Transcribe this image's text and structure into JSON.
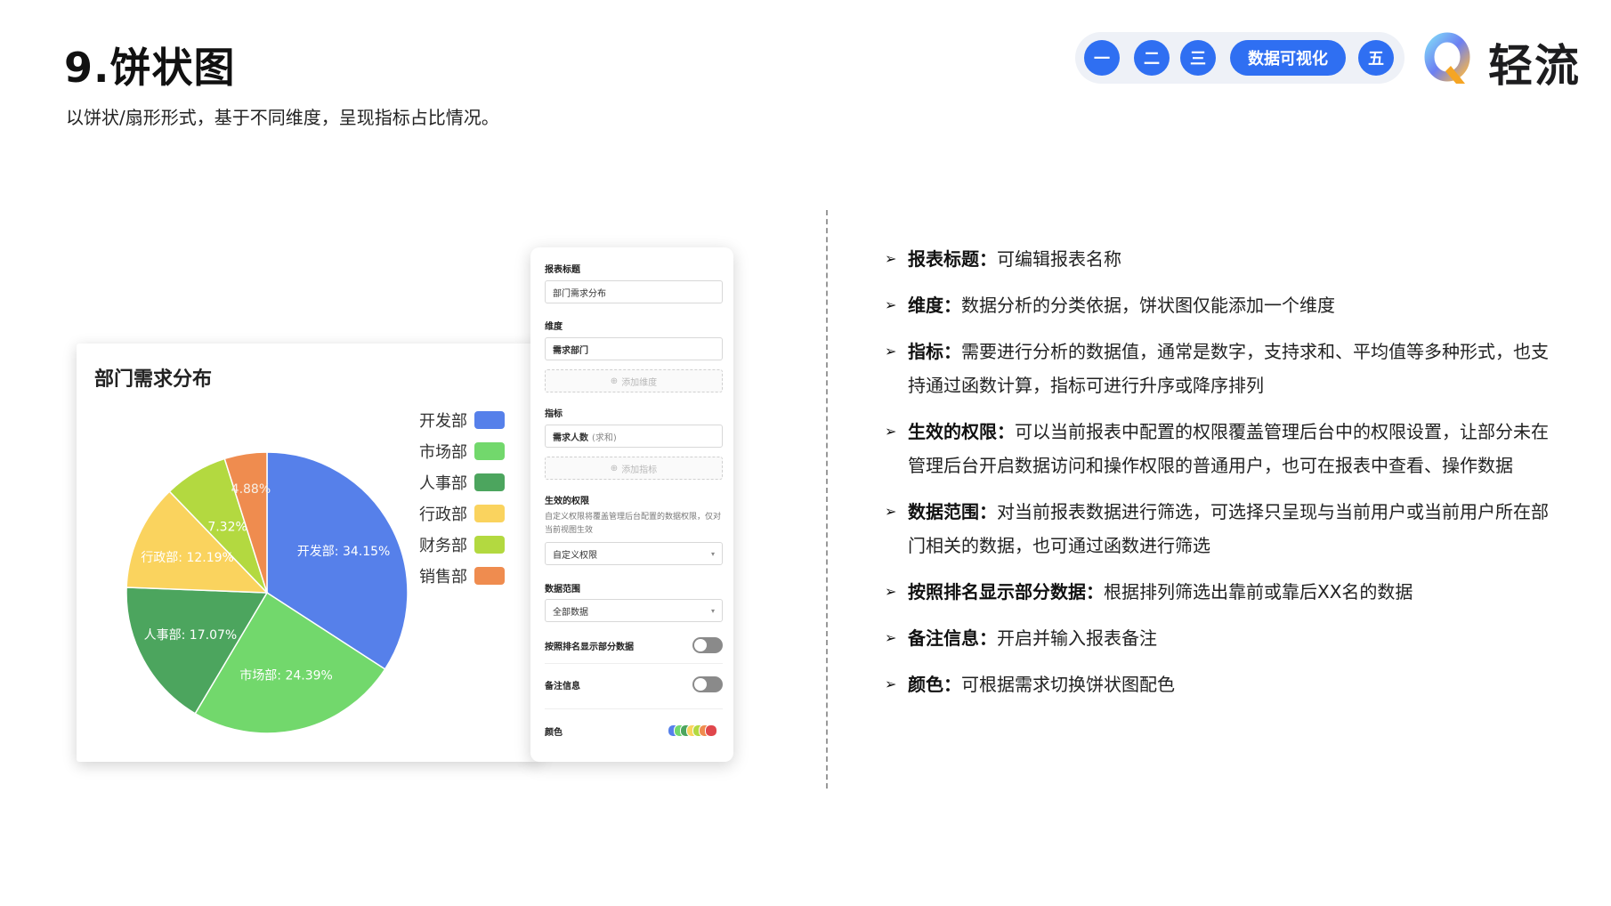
{
  "page": {
    "title": "9.饼状图",
    "subtitle": "以饼状/扇形形式，基于不同维度，呈现指标占比情况。"
  },
  "nav": {
    "items": [
      "一",
      "二",
      "三",
      "数据可视化",
      "五"
    ],
    "active_index": 3,
    "accent_color": "#2f6ff2"
  },
  "logo": {
    "text": "轻流",
    "icon": "q-logo-icon"
  },
  "chart_data": {
    "type": "pie",
    "title": "部门需求分布",
    "categories": [
      "开发部",
      "市场部",
      "人事部",
      "行政部",
      "财务部",
      "销售部"
    ],
    "values": [
      34.15,
      24.39,
      17.07,
      12.19,
      7.32,
      4.88
    ],
    "data_labels": [
      "开发部: 34.15%",
      "市场部: 24.39%",
      "人事部: 17.07%",
      "行政部: 12.19%",
      "7.32%",
      "4.88%"
    ],
    "colors": [
      "#5680ea",
      "#72d86c",
      "#4ca55e",
      "#fad35e",
      "#b3d940",
      "#ef8c4f"
    ],
    "legend_position": "right"
  },
  "config_panel": {
    "title_label": "报表标题",
    "title_value": "部门需求分布",
    "dimension_label": "维度",
    "dimension_value": "需求部门",
    "add_dimension": "添加维度",
    "metric_label": "指标",
    "metric_value": "需求人数",
    "metric_agg": "(求和)",
    "add_metric": "添加指标",
    "permission_label": "生效的权限",
    "permission_hint": "自定义权限将覆盖管理后台配置的数据权限，仅对当前视图生效",
    "permission_value": "自定义权限",
    "range_label": "数据范围",
    "range_value": "全部数据",
    "rank_label": "按照排名显示部分数据",
    "rank_enabled": false,
    "note_label": "备注信息",
    "note_enabled": false,
    "color_label": "颜色",
    "palette": [
      "#5680ea",
      "#72d86c",
      "#4ca55e",
      "#fad35e",
      "#b3d940",
      "#ef8c4f",
      "#e0474c"
    ]
  },
  "features": [
    {
      "name": "报表标题：",
      "desc": "可编辑报表名称"
    },
    {
      "name": "维度：",
      "desc": "数据分析的分类依据，饼状图仅能添加一个维度"
    },
    {
      "name": "指标：",
      "desc": "需要进行分析的数据值，通常是数字，支持求和、平均值等多种形式，也支持通过函数计算，指标可进行升序或降序排列"
    },
    {
      "name": "生效的权限：",
      "desc": "可以当前报表中配置的权限覆盖管理后台中的权限设置，让部分未在管理后台开启数据访问和操作权限的普通用户，也可在报表中查看、操作数据"
    },
    {
      "name": "数据范围：",
      "desc": "对当前报表数据进行筛选，可选择只呈现与当前用户或当前用户所在部门相关的数据，也可通过函数进行筛选"
    },
    {
      "name": "按照排名显示部分数据：",
      "desc": "根据排列筛选出靠前或靠后XX名的数据"
    },
    {
      "name": "备注信息：",
      "desc": "开启并输入报表备注"
    },
    {
      "name": "颜色：",
      "desc": "可根据需求切换饼状图配色"
    }
  ]
}
